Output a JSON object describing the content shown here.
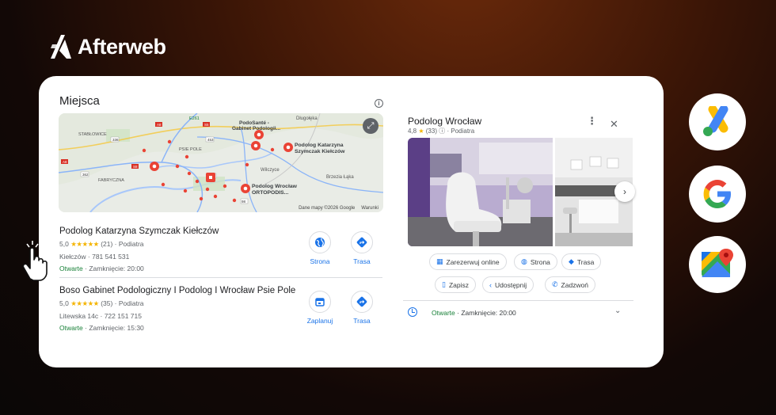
{
  "brand": {
    "name": "Afterweb"
  },
  "places": {
    "title": "Miejsca",
    "info_icon": "info-icon",
    "map": {
      "footer_data": "Dane mapy ©2026 Google",
      "footer_terms": "Warunki",
      "road_labels": [
        "A8",
        "E261",
        "S5",
        "453",
        "336",
        "A8",
        "362",
        "S8",
        "94",
        "98",
        "A4"
      ],
      "place_labels": [
        "STABŁOWICE",
        "PSIE POLE",
        "FABRYCZNA",
        "Długołęka",
        "Wilczyce",
        "Brzezia Łąka"
      ],
      "pins": [
        "PodoSanté - Gabinet Podologii...",
        "Podolog Katarzyna Szymczak Kiełczów",
        "Podolog Wrocław ORTOPODIS..."
      ]
    },
    "listings": [
      {
        "name": "Podolog Katarzyna Szymczak Kiełczów",
        "rating": "5,0",
        "stars": "★★★★★",
        "reviews": "(21)",
        "category": "Podiatra",
        "address": "Kiełczów · 781 541 531",
        "open": "Otwarte",
        "hours": "· Zamknięcie: 20:00",
        "btn1": "Strona",
        "btn2": "Trasa"
      },
      {
        "name": "Boso Gabinet Podologiczny I Podolog I Wrocław Psie Pole",
        "rating": "5,0",
        "stars": "★★★★★",
        "reviews": "(35)",
        "category": "Podiatra",
        "address": "Litewska 14c · 722 151 715",
        "open": "Otwarte",
        "hours": "· Zamknięcie: 15:30",
        "btn1": "Zaplanuj",
        "btn2": "Trasa"
      }
    ]
  },
  "detail": {
    "title": "Podolog Wrocław",
    "rating": "4,8",
    "star": "★",
    "reviews": "(33)",
    "category": "· Podiatra",
    "chips": {
      "reserve": "Zarezerwuj online",
      "website": "Strona",
      "route": "Trasa",
      "save": "Zapisz",
      "share": "Udostępnij",
      "call": "Zadzwoń"
    },
    "open": "Otwarte",
    "hours": "· Zamknięcie: 20:00"
  },
  "side_icons": [
    "google-ads-icon",
    "google-icon",
    "google-maps-icon"
  ],
  "colors": {
    "accent": "#1a73e8",
    "open": "#188038",
    "star": "#f4b400"
  }
}
